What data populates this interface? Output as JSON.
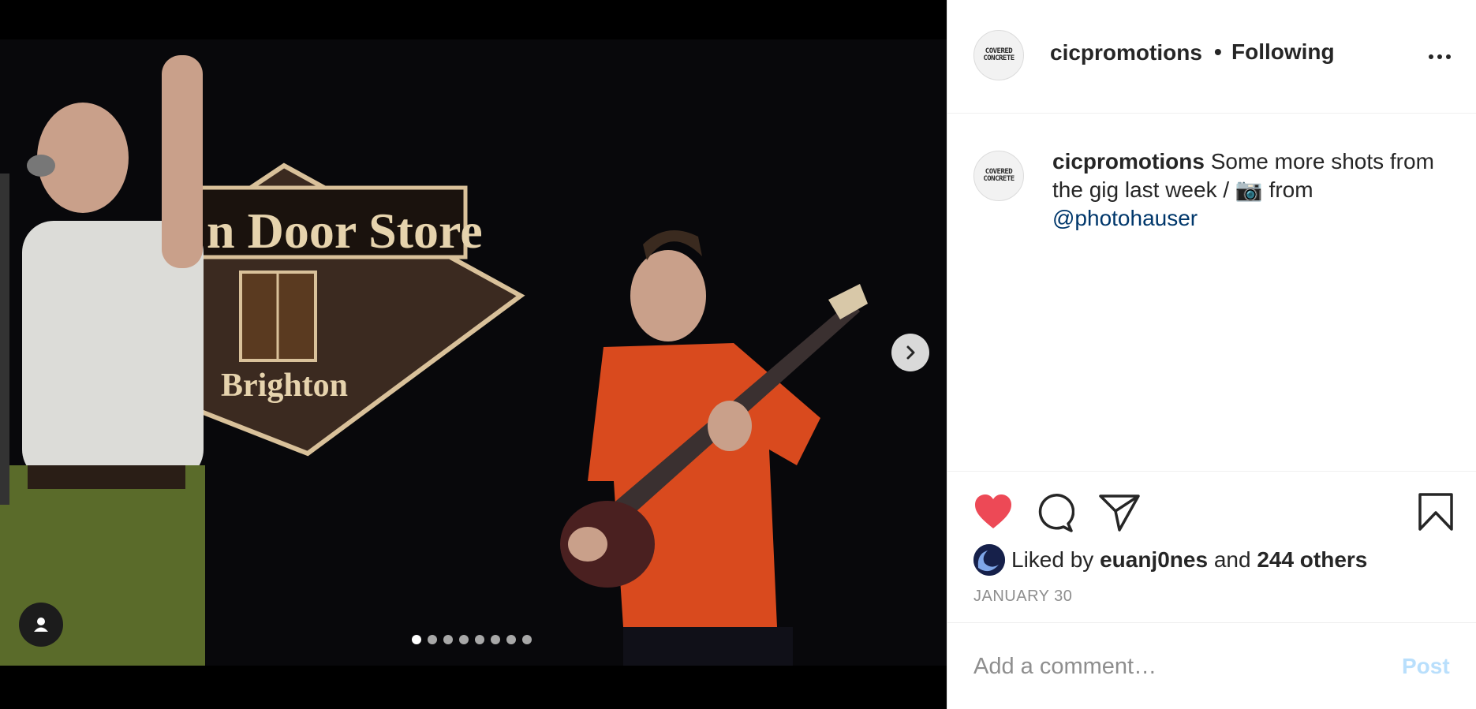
{
  "post": {
    "username": "cicpromotions",
    "separator": "•",
    "follow_label": "Following",
    "avatar_text": "COVERED CONCRETE",
    "caption": {
      "username": "cicpromotions",
      "text": " Some more shots from the gig last week / 📷 from ",
      "mention": "@photohauser"
    }
  },
  "media": {
    "slide_count": 8,
    "active_slide": 1,
    "sign_text_top": "n Door Store",
    "sign_text_bottom": "Brighton"
  },
  "likes": {
    "prefix": "Liked by",
    "liker": "euanj0nes",
    "conjunction": "and",
    "others": "244 others"
  },
  "date": "JANUARY 30",
  "comment": {
    "placeholder": "Add a comment…",
    "post_label": "Post"
  },
  "colors": {
    "heart": "#ed4956",
    "mention": "#00376b",
    "post_disabled": "#b9dffc",
    "shirt": "#d94a1e",
    "pants": "#5a6b2a"
  }
}
